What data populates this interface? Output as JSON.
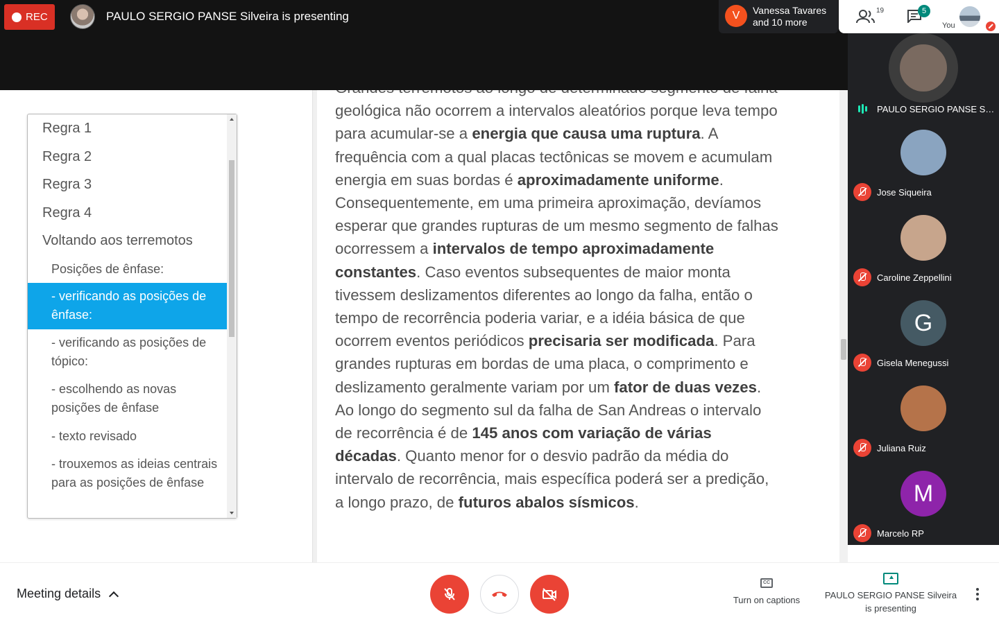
{
  "header": {
    "rec_label": "REC",
    "presenting_title": "PAULO SERGIO PANSE Silveira is presenting",
    "others": {
      "initial": "V",
      "line1": "Vanessa Tavares",
      "line2": "and 10 more"
    },
    "people_count": "19",
    "chat_badge": "5",
    "you_label": "You"
  },
  "participants": [
    {
      "name": "PAULO SERGIO PANSE Sil...",
      "initial": "",
      "color": "#7a6a60",
      "speaking": true
    },
    {
      "name": "Jose Siqueira",
      "initial": "",
      "color": "#8aa4c0",
      "speaking": false
    },
    {
      "name": "Caroline Zeppellini",
      "initial": "",
      "color": "#c7a58c",
      "speaking": false
    },
    {
      "name": "Gisela Menegussi",
      "initial": "G",
      "color": "#455a64",
      "speaking": false
    },
    {
      "name": "Juliana Ruiz",
      "initial": "",
      "color": "#b5734a",
      "speaking": false
    },
    {
      "name": "Marcelo RP",
      "initial": "M",
      "color": "#8e24aa",
      "speaking": false
    }
  ],
  "outline": {
    "items": [
      {
        "label": "Regra 1",
        "level": "top"
      },
      {
        "label": "Regra 2",
        "level": "top"
      },
      {
        "label": "Regra 3",
        "level": "top"
      },
      {
        "label": "Regra 4",
        "level": "top"
      },
      {
        "label": "Voltando aos terremotos",
        "level": "top"
      },
      {
        "label": "Posições de ênfase:",
        "level": "sub"
      },
      {
        "label": "- verificando as posições de ênfase:",
        "level": "sub",
        "selected": true
      },
      {
        "label": "- verificando as posições de tópico:",
        "level": "sub"
      },
      {
        "label": "- escolhendo as novas posições de ênfase",
        "level": "sub"
      },
      {
        "label": "- texto revisado",
        "level": "sub"
      },
      {
        "label": "- trouxemos as ideias centrais para as posições de ênfase",
        "level": "sub"
      }
    ]
  },
  "document": {
    "paragraph": [
      {
        "t": "Grandes terremotos ao longo de determinado segmento de falha geológica não ocorrem a intervalos aleatórios porque leva tempo para acumular-se a ",
        "b": false
      },
      {
        "t": "energia que causa uma ruptura",
        "b": true
      },
      {
        "t": ". A frequência com a qual placas tectônicas se movem e acumulam energia em suas bordas é ",
        "b": false
      },
      {
        "t": "aproximadamente uniforme",
        "b": true
      },
      {
        "t": ". Consequentemente, em uma primeira aproximação, devíamos esperar que grandes rupturas de um mesmo segmento de falhas ocorressem a ",
        "b": false
      },
      {
        "t": "intervalos de tempo aproximadamente constantes",
        "b": true
      },
      {
        "t": ". Caso eventos subsequentes de maior monta tivessem deslizamentos diferentes ao longo da falha, então o tempo de recorrência poderia variar, e a idéia básica de que ocorrem eventos periódicos ",
        "b": false
      },
      {
        "t": "precisaria ser modificada",
        "b": true
      },
      {
        "t": ". Para grandes rupturas em bordas de uma placa, o comprimento e deslizamento geralmente variam por um ",
        "b": false
      },
      {
        "t": "fator de duas vezes",
        "b": true
      },
      {
        "t": ". Ao longo do segmento sul da falha de San Andreas o intervalo de recorrência é de ",
        "b": false
      },
      {
        "t": "145 anos com variação de várias décadas",
        "b": true
      },
      {
        "t": ". Quanto menor for o desvio padrão da média do intervalo de recorrência, mais específica poderá ser a predição, a longo prazo, de ",
        "b": false
      },
      {
        "t": "futuros abalos sísmicos",
        "b": true
      },
      {
        "t": ".",
        "b": false
      }
    ]
  },
  "bottom": {
    "meeting_details": "Meeting details",
    "captions_label": "Turn on captions",
    "presenting_label": "PAULO SERGIO PANSE Silveira is presenting"
  },
  "colors": {
    "rec": "#d93025",
    "mute_red": "#ea4335",
    "selection": "#0ea5e9",
    "present_accent": "#00897b"
  }
}
